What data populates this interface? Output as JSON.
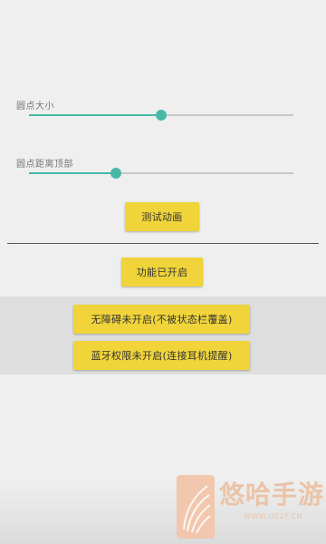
{
  "settings": {
    "dot_size": {
      "label": "圆点大小",
      "value_fraction": 0.5
    },
    "dot_distance": {
      "label": "圆点距离顶部",
      "value_fraction": 0.33
    }
  },
  "buttons": {
    "test_animation": "测试动画",
    "feature_status": "功能已开启",
    "accessibility": "无障碍未开启(不被状态栏覆盖)",
    "bluetooth": "蓝牙权限未开启(连接耳机提醒)"
  },
  "watermark": {
    "title": "悠哈手游",
    "url": "WWW.UZZF.CN"
  },
  "colors": {
    "accent": "#48b8a6",
    "button": "#f0d43a",
    "background": "#efefef"
  }
}
